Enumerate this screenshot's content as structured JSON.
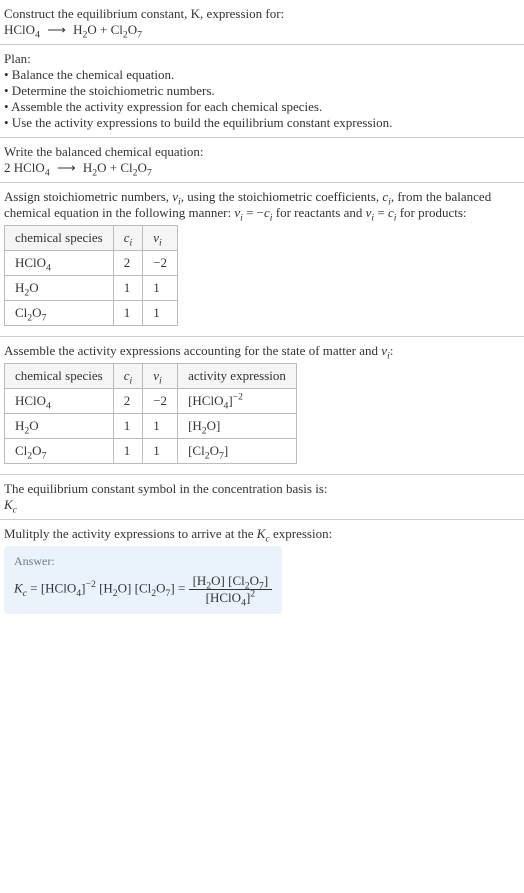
{
  "intro": {
    "line1": "Construct the equilibrium constant, K, expression for:",
    "eq_lhs": "HClO",
    "eq_lhs_sub": "4",
    "eq_rhs1": "H",
    "eq_rhs1_sub": "2",
    "eq_rhs1b": "O + Cl",
    "eq_rhs1b_sub": "2",
    "eq_rhs1c": "O",
    "eq_rhs1c_sub": "7"
  },
  "plan": {
    "header": "Plan:",
    "items": [
      "• Balance the chemical equation.",
      "• Determine the stoichiometric numbers.",
      "• Assemble the activity expression for each chemical species.",
      "• Use the activity expressions to build the equilibrium constant expression."
    ]
  },
  "balanced": {
    "header": "Write the balanced chemical equation:",
    "coef": "2 ",
    "lhs": "HClO",
    "lhs_sub": "4",
    "rhs1": "H",
    "rhs1_sub": "2",
    "rhs1b": "O + Cl",
    "rhs1b_sub": "2",
    "rhs1c": "O",
    "rhs1c_sub": "7"
  },
  "stoich": {
    "text_a": "Assign stoichiometric numbers, ",
    "nu": "ν",
    "nu_sub": "i",
    "text_b": ", using the stoichiometric coefficients, ",
    "c": "c",
    "c_sub": "i",
    "text_c": ", from the balanced chemical equation in the following manner: ",
    "rel1a": "ν",
    "rel1a_sub": "i",
    "rel1b": " = −",
    "rel1c": "c",
    "rel1c_sub": "i",
    "text_d": " for reactants and ",
    "rel2a": "ν",
    "rel2a_sub": "i",
    "rel2b": " = ",
    "rel2c": "c",
    "rel2c_sub": "i",
    "text_e": " for products:",
    "headers": {
      "species": "chemical species",
      "ci": "c",
      "ci_sub": "i",
      "nui": "ν",
      "nui_sub": "i"
    },
    "rows": [
      {
        "sp_a": "HClO",
        "sp_sub": "4",
        "sp_b": "",
        "sp_sub2": "",
        "ci": "2",
        "nui": "−2"
      },
      {
        "sp_a": "H",
        "sp_sub": "2",
        "sp_b": "O",
        "sp_sub2": "",
        "ci": "1",
        "nui": "1"
      },
      {
        "sp_a": "Cl",
        "sp_sub": "2",
        "sp_b": "O",
        "sp_sub2": "7",
        "ci": "1",
        "nui": "1"
      }
    ]
  },
  "activity": {
    "text_a": "Assemble the activity expressions accounting for the state of matter and ",
    "nu": "ν",
    "nu_sub": "i",
    "text_b": ":",
    "headers": {
      "species": "chemical species",
      "ci": "c",
      "ci_sub": "i",
      "nui": "ν",
      "nui_sub": "i",
      "act": "activity expression"
    },
    "rows": [
      {
        "sp_a": "HClO",
        "sp_sub": "4",
        "sp_b": "",
        "sp_sub2": "",
        "ci": "2",
        "nui": "−2",
        "act_a": "[HClO",
        "act_sub": "4",
        "act_b": "]",
        "act_sup": "−2"
      },
      {
        "sp_a": "H",
        "sp_sub": "2",
        "sp_b": "O",
        "sp_sub2": "",
        "ci": "1",
        "nui": "1",
        "act_a": "[H",
        "act_sub": "2",
        "act_b": "O]",
        "act_sup": ""
      },
      {
        "sp_a": "Cl",
        "sp_sub": "2",
        "sp_b": "O",
        "sp_sub2": "7",
        "ci": "1",
        "nui": "1",
        "act_a": "[Cl",
        "act_sub": "2",
        "act_b": "O",
        "act_sub2": "7",
        "act_c": "]",
        "act_sup": ""
      }
    ]
  },
  "symbol": {
    "text": "The equilibrium constant symbol in the concentration basis is:",
    "K": "K",
    "K_sub": "c"
  },
  "multiply": {
    "text_a": "Mulitply the activity expressions to arrive at the ",
    "K": "K",
    "K_sub": "c",
    "text_b": " expression:"
  },
  "answer": {
    "label": "Answer:",
    "K": "K",
    "K_sub": "c",
    "eq": " = ",
    "t1": "[HClO",
    "t1_sub": "4",
    "t1b": "]",
    "t1_sup": "−2",
    "t2": " [H",
    "t2_sub": "2",
    "t2b": "O] [Cl",
    "t2b_sub": "2",
    "t2c": "O",
    "t2c_sub": "7",
    "t2d": "] = ",
    "num_a": "[H",
    "num_a_sub": "2",
    "num_b": "O] [Cl",
    "num_b_sub": "2",
    "num_c": "O",
    "num_c_sub": "7",
    "num_d": "]",
    "den_a": "[HClO",
    "den_a_sub": "4",
    "den_b": "]",
    "den_sup": "2"
  },
  "arrow": "⟶"
}
